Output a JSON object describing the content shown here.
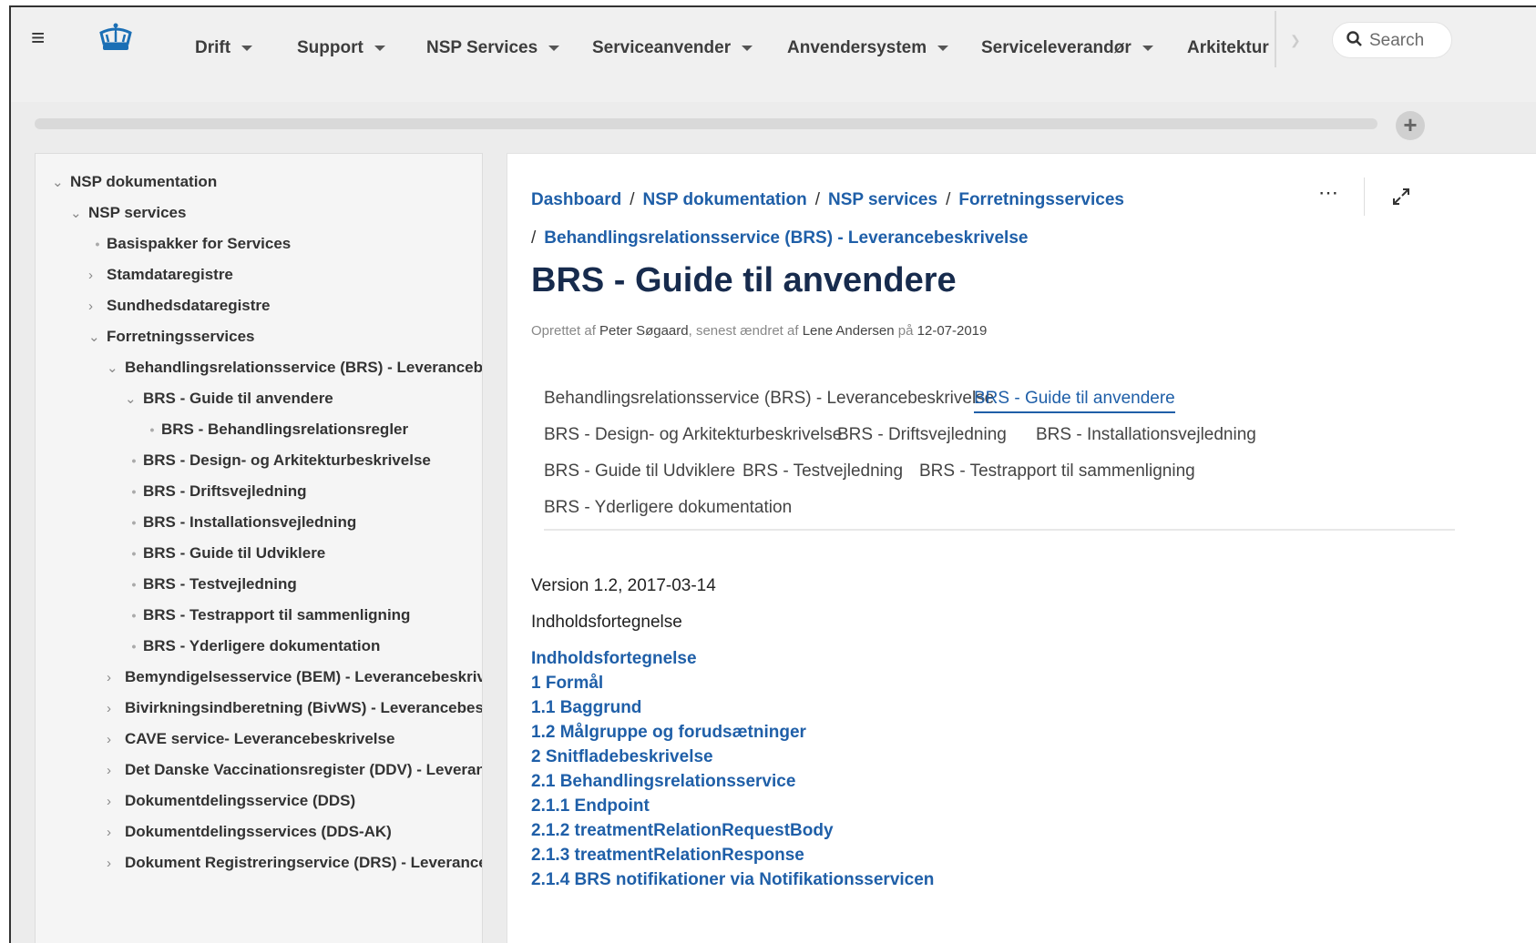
{
  "nav": {
    "menu_icon": "hamburger-icon",
    "logo_icon": "crown-logo-icon",
    "items": [
      {
        "label": "Drift",
        "dropdown": true
      },
      {
        "label": "Support",
        "dropdown": true
      },
      {
        "label": "NSP Services",
        "dropdown": true
      },
      {
        "label": "Serviceanvender",
        "dropdown": true
      },
      {
        "label": "Anvendersystem",
        "dropdown": true
      },
      {
        "label": "Serviceleverandør",
        "dropdown": true
      },
      {
        "label": "Arkitektur",
        "dropdown": false
      }
    ],
    "search": {
      "placeholder": "Search",
      "icon": "search-icon"
    }
  },
  "sidebar": {
    "items": [
      {
        "label": "NSP dokumentation",
        "type": "expanded"
      },
      {
        "label": "NSP services",
        "type": "expanded"
      },
      {
        "label": "Basispakker for Services",
        "type": "leaf"
      },
      {
        "label": "Stamdataregistre",
        "type": "collapsed"
      },
      {
        "label": "Sundhedsdataregistre",
        "type": "collapsed"
      },
      {
        "label": "Forretningsservices",
        "type": "expanded"
      },
      {
        "label": "Behandlingsrelationsservice (BRS) - Leverancebe...",
        "type": "expanded"
      },
      {
        "label": "BRS - Guide til anvendere",
        "type": "expanded"
      },
      {
        "label": "BRS - Behandlingsrelationsregler",
        "type": "leaf"
      },
      {
        "label": "BRS - Design- og Arkitekturbeskrivelse",
        "type": "leaf"
      },
      {
        "label": "BRS - Driftsvejledning",
        "type": "leaf"
      },
      {
        "label": "BRS - Installationsvejledning",
        "type": "leaf"
      },
      {
        "label": "BRS - Guide til Udviklere",
        "type": "leaf"
      },
      {
        "label": "BRS - Testvejledning",
        "type": "leaf"
      },
      {
        "label": "BRS - Testrapport til sammenligning",
        "type": "leaf"
      },
      {
        "label": "BRS - Yderligere dokumentation",
        "type": "leaf"
      },
      {
        "label": "Bemyndigelsesservice (BEM) - Leverancebeskrive...",
        "type": "collapsed"
      },
      {
        "label": "Bivirkningsindberetning (BivWS) - Leverancebes...",
        "type": "collapsed"
      },
      {
        "label": "CAVE service- Leverancebeskrivelse",
        "type": "collapsed"
      },
      {
        "label": "Det Danske Vaccinationsregister (DDV) - Leveran...",
        "type": "collapsed"
      },
      {
        "label": "Dokumentdelingsservice (DDS)",
        "type": "collapsed"
      },
      {
        "label": "Dokumentdelingsservices (DDS-AK)",
        "type": "collapsed"
      },
      {
        "label": "Dokument Registreringservice (DRS) - Leverance...",
        "type": "collapsed"
      }
    ]
  },
  "breadcrumbs": [
    "Dashboard",
    "NSP dokumentation",
    "NSP services",
    "Forretningsservices",
    "Behandlingsrelationsservice (BRS) - Leverancebeskrivelse"
  ],
  "page": {
    "title": "BRS - Guide til anvendere",
    "meta": {
      "created_prefix": "Oprettet af",
      "creator": "Peter Søgaard",
      "modified_prefix": ", senest ændret af",
      "modifier": "Lene Andersen",
      "date_prefix": "på",
      "date": "12-07-2019"
    },
    "tabs": [
      "Behandlingsrelationsservice (BRS) - Leverancebeskrivelse",
      "BRS - Guide til anvendere",
      "BRS - Design- og Arkitekturbeskrivelse",
      "BRS - Driftsvejledning",
      "BRS - Installationsvejledning",
      "BRS - Guide til Udviklere",
      "BRS - Testvejledning",
      "BRS - Testrapport til sammenligning",
      "BRS - Yderligere dokumentation"
    ],
    "active_tab": "BRS - Guide til anvendere",
    "version": "Version 1.2, 2017-03-14",
    "toc_heading": "Indholdsfortegnelse",
    "toc": [
      "Indholdsfortegnelse",
      "1 Formål",
      "1.1 Baggrund",
      "1.2 Målgruppe og forudsætninger",
      "2 Snitfladebeskrivelse",
      "2.1 Behandlingsrelationsservice",
      "2.1.1 Endpoint",
      "2.1.2 treatmentRelationRequestBody",
      "2.1.3 treatmentRelationResponse",
      "2.1.4 BRS notifikationer via Notifikationsservicen"
    ]
  },
  "actions": {
    "more_icon": "more-options-icon",
    "expand_icon": "expand-icon",
    "add_icon": "plus-icon"
  },
  "colors": {
    "link": "#1f5fa8",
    "title": "#172b4d",
    "logo": "#1b6fb5"
  }
}
